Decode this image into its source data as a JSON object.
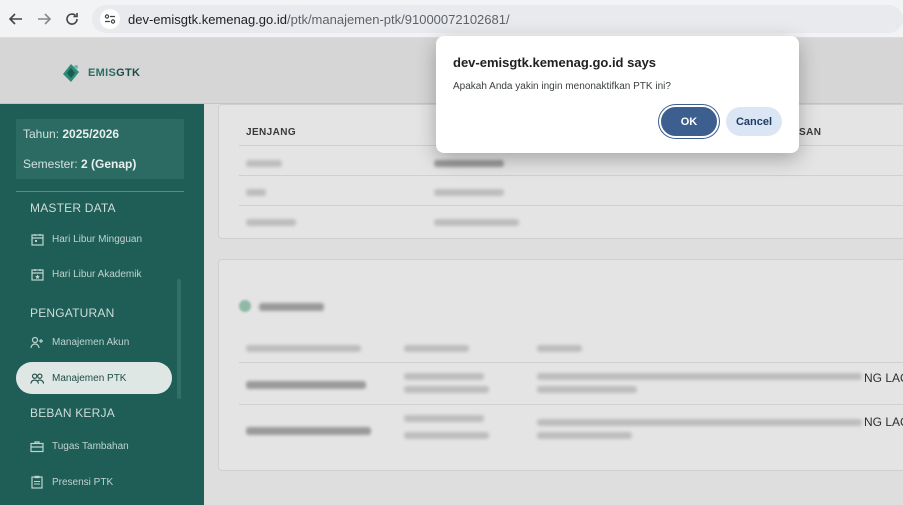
{
  "browser": {
    "url_host": "dev-emisgtk.kemenag.go.id",
    "url_path": "/ptk/manajemen-ptk/91000072102681/"
  },
  "app": {
    "logo_text_a": "EMIS",
    "logo_text_b": "GTK"
  },
  "sidebar": {
    "year_label": "Tahun: ",
    "year_value": "2025/2026",
    "semester_label": "Semester: ",
    "semester_value": "2 (Genap)",
    "sections": [
      {
        "title": "MASTER DATA"
      },
      {
        "title": "PENGATURAN"
      },
      {
        "title": "BEBAN KERJA"
      }
    ],
    "items": [
      {
        "label": "Hari Libur Mingguan",
        "icon": "calendar-icon"
      },
      {
        "label": "Hari Libur Akademik",
        "icon": "calendar-star-icon"
      },
      {
        "label": "Manajemen Akun",
        "icon": "user-plus-icon"
      },
      {
        "label": "Manajemen PTK",
        "icon": "users-icon"
      },
      {
        "label": "Tugas Tambahan",
        "icon": "briefcase-icon"
      },
      {
        "label": "Presensi PTK",
        "icon": "clipboard-icon"
      }
    ]
  },
  "content": {
    "table1_header_jenjang": "JENJANG",
    "table1_header_right_partial": "SAN",
    "card2_trunc_1": "NG LAO",
    "card2_trunc_2": "NG LAO"
  },
  "dialog": {
    "title": "dev-emisgtk.kemenag.go.id says",
    "message": "Apakah Anda yakin ingin menonaktifkan PTK ini?",
    "ok_label": "OK",
    "cancel_label": "Cancel"
  },
  "colors": {
    "sidebar_bg": "#1e5e56",
    "ok_button": "#3d5f8f",
    "cancel_button": "#dbe6f5"
  }
}
